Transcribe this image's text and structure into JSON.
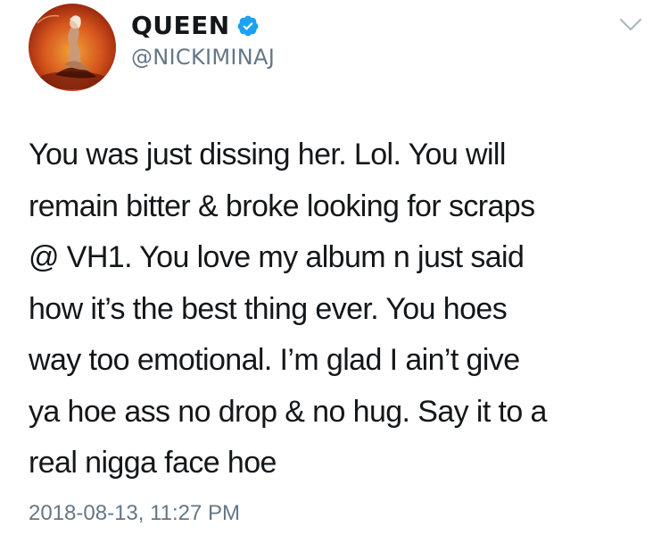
{
  "author": {
    "display_name": "QUEEN",
    "handle": "@NICKIMINAJ",
    "verified": true,
    "avatar_icon": "profile-avatar"
  },
  "menu": {
    "icon": "chevron-down-icon"
  },
  "tweet": {
    "text": "You was just dissing her. Lol. You will\nremain bitter & broke looking for scraps\n@ VH1. You love my album n just said\nhow it’s the best thing ever. You hoes\nway too emotional. I’m glad  I ain’t give\nya hoe ass no drop & no hug. Say it to a\nreal nigga face hoe",
    "timestamp": "2018-08-13, 11:27 PM"
  },
  "colors": {
    "text": "#14171a",
    "secondary": "#657786",
    "verified_badge": "#1da1f2",
    "background": "#ffffff"
  }
}
